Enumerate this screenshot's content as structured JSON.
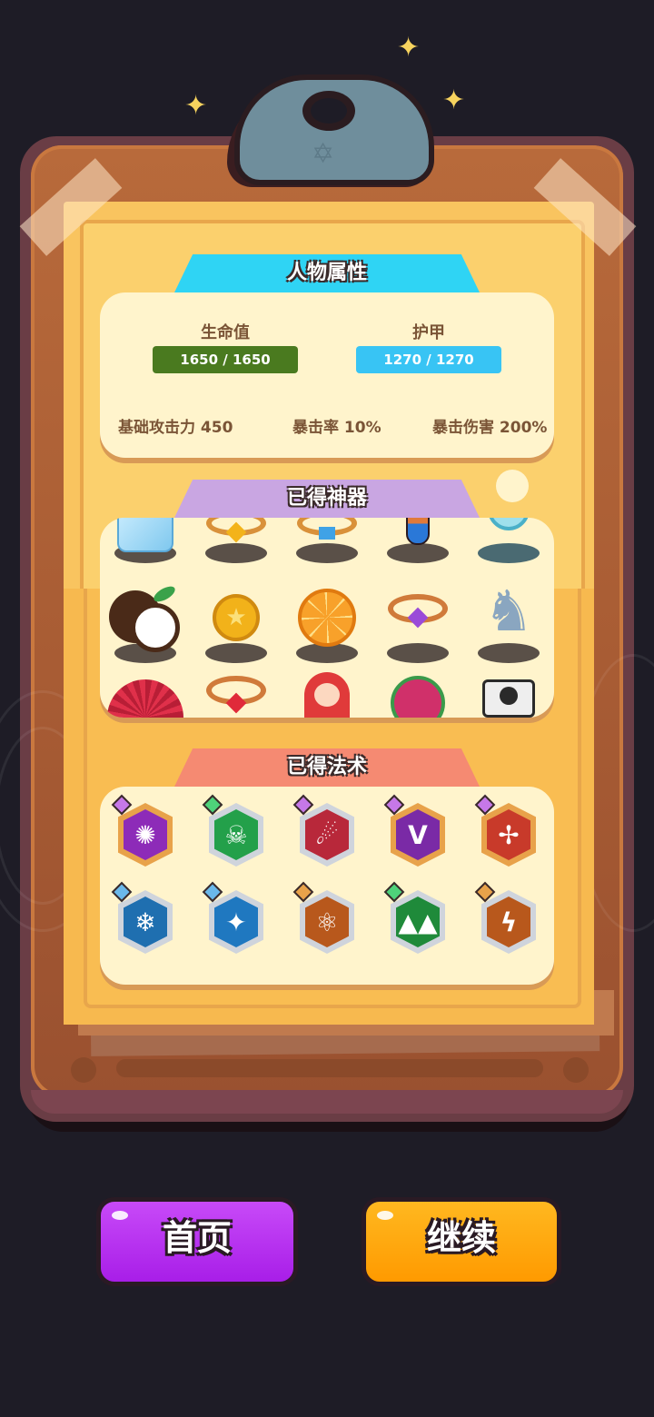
{
  "colors": {
    "background": "#1e1c26",
    "hp_bar": "#4a7a1f",
    "armor_bar": "#38c4f4",
    "tab_attributes": "#2fd4f4",
    "tab_artifacts": "#c9a6e2",
    "tab_spells": "#f58a72",
    "home_button": "#b42cf0",
    "continue_button": "#ffa90a"
  },
  "attributes": {
    "title": "人物属性",
    "hp_label": "生命值",
    "hp_value": "1650 / 1650",
    "hp_fraction": 1.0,
    "armor_label": "护甲",
    "armor_value": "1270 / 1270",
    "armor_fraction": 1.0,
    "base_attack": "基础攻击力 450",
    "crit_rate": "暴击率 10%",
    "crit_damage": "暴击伤害 200%"
  },
  "artifacts": {
    "title": "已得神器",
    "items": [
      {
        "icon": "ice-cube-icon"
      },
      {
        "icon": "gold-ring-topaz-icon"
      },
      {
        "icon": "gold-ring-diamond-icon"
      },
      {
        "icon": "potion-flask-icon"
      },
      {
        "icon": "desk-fan-icon"
      },
      {
        "icon": "coconut-icon"
      },
      {
        "icon": "gold-coin-icon"
      },
      {
        "icon": "orange-slice-icon"
      },
      {
        "icon": "ring-amethyst-icon"
      },
      {
        "icon": "chess-knight-icon"
      },
      {
        "icon": "folding-fan-icon"
      },
      {
        "icon": "ring-ruby-icon"
      },
      {
        "icon": "matryoshka-doll-icon"
      },
      {
        "icon": "dragon-fruit-icon"
      },
      {
        "icon": "camera-icon"
      }
    ]
  },
  "spells": {
    "title": "已得法术",
    "items": [
      {
        "icon": "orb-ring-spell-icon",
        "glyph": "✺",
        "frame": "#e8a24a",
        "fill": "#8d2bb8",
        "gem": "#c678e8"
      },
      {
        "icon": "poison-bottle-spell-icon",
        "glyph": "☠",
        "frame": "#cfd4dc",
        "fill": "#23a04a",
        "gem": "#4ed27a"
      },
      {
        "icon": "fireball-spell-icon",
        "glyph": "☄",
        "frame": "#cfd4dc",
        "fill": "#b8283a",
        "gem": "#c678e8"
      },
      {
        "icon": "purple-fork-spell-icon",
        "glyph": "ᐯ",
        "frame": "#e8a24a",
        "fill": "#7a2aa6",
        "gem": "#c678e8"
      },
      {
        "icon": "whirl-spell-icon",
        "glyph": "✢",
        "frame": "#e8a24a",
        "fill": "#c83a2a",
        "gem": "#c678e8"
      },
      {
        "icon": "ice-shards-spell-icon",
        "glyph": "❄",
        "frame": "#cfd4dc",
        "fill": "#1f6fb0",
        "gem": "#6ab8ea"
      },
      {
        "icon": "ice-blade-spell-icon",
        "glyph": "✦",
        "frame": "#cfd4dc",
        "fill": "#1f78c0",
        "gem": "#6ab8ea"
      },
      {
        "icon": "molecule-spell-icon",
        "glyph": "⚛",
        "frame": "#cfd4dc",
        "fill": "#b8581c",
        "gem": "#e8a24a"
      },
      {
        "icon": "green-spikes-spell-icon",
        "glyph": "▲▲",
        "frame": "#cfd4dc",
        "fill": "#1f8a3a",
        "gem": "#4ed27a"
      },
      {
        "icon": "lightning-spell-icon",
        "glyph": "ϟ",
        "frame": "#cfd4dc",
        "fill": "#b8581c",
        "gem": "#e8a24a"
      }
    ]
  },
  "buttons": {
    "home_label": "首页",
    "continue_label": "继续"
  }
}
